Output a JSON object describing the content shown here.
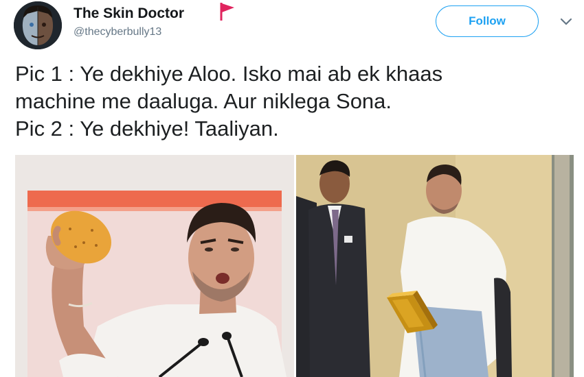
{
  "tweet": {
    "user": {
      "name": "The Skin Doctor",
      "handle": "@thecyberbully13",
      "avatar_icon": "avatar-half-face-icon",
      "badge_icon": "red-flag-icon"
    },
    "follow_label": "Follow",
    "menu_icon": "chevron-down-icon",
    "text_lines": [
      "Pic 1 : Ye dekhiye Aloo. Isko mai ab ek khaas",
      "machine me daaluga. Aur niklega Sona.",
      "Pic 2 : Ye dekhiye! Taaliyan."
    ],
    "photos": [
      {
        "name": "photo-man-holding-potato",
        "icon": "potato-icon"
      },
      {
        "name": "photo-man-with-gold-bar",
        "icon": "gold-bar-icon"
      }
    ]
  },
  "colors": {
    "accent": "#1da1f2",
    "text": "#14171a",
    "secondary": "#657786",
    "flag": "#e0245e"
  }
}
